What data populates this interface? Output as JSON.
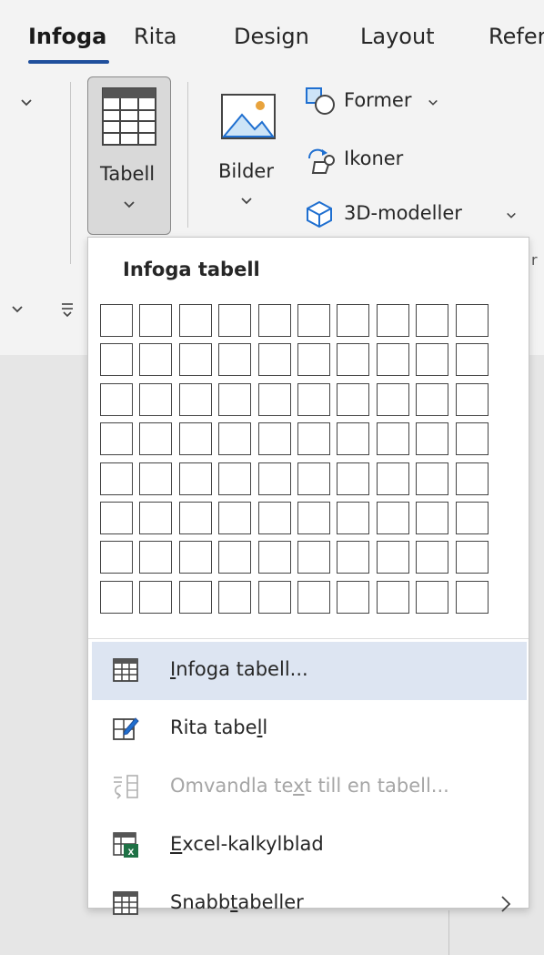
{
  "ribbon_tabs": [
    {
      "label": "Infoga",
      "active": true
    },
    {
      "label": "Rita",
      "active": false
    },
    {
      "label": "Design",
      "active": false
    },
    {
      "label": "Layout",
      "active": false
    },
    {
      "label": "Refer",
      "active": false
    }
  ],
  "ribbon": {
    "tabell_label": "Tabell",
    "bilder_label": "Bilder",
    "former_label": "Former",
    "ikoner_label": "Ikoner",
    "modeller_label": "3D-modeller"
  },
  "dropdown": {
    "title": "Infoga tabell",
    "grid_columns": 10,
    "grid_rows": 8,
    "items": [
      {
        "pre": "",
        "key": "I",
        "post": "nfoga tabell...",
        "icon": "table-icon",
        "highlighted": true,
        "disabled": false
      },
      {
        "pre": "Rita tabe",
        "key": "l",
        "post": "l",
        "icon": "draw-table-icon",
        "highlighted": false,
        "disabled": false
      },
      {
        "pre": "Omvandla te",
        "key": "x",
        "post": "t till en tabell...",
        "icon": "convert-text-icon",
        "highlighted": false,
        "disabled": true
      },
      {
        "pre": "",
        "key": "E",
        "post": "xcel-kalkylblad",
        "icon": "excel-icon",
        "highlighted": false,
        "disabled": false
      },
      {
        "pre": "Snabb",
        "key": "t",
        "post": "abeller",
        "icon": "quick-tables-icon",
        "highlighted": false,
        "disabled": false,
        "submenu": true
      }
    ]
  },
  "colors": {
    "accent": "#1f4f9c",
    "highlight": "#dde5f2",
    "excel_green": "#1e7145",
    "shape_blue": "#1f6fd0"
  }
}
